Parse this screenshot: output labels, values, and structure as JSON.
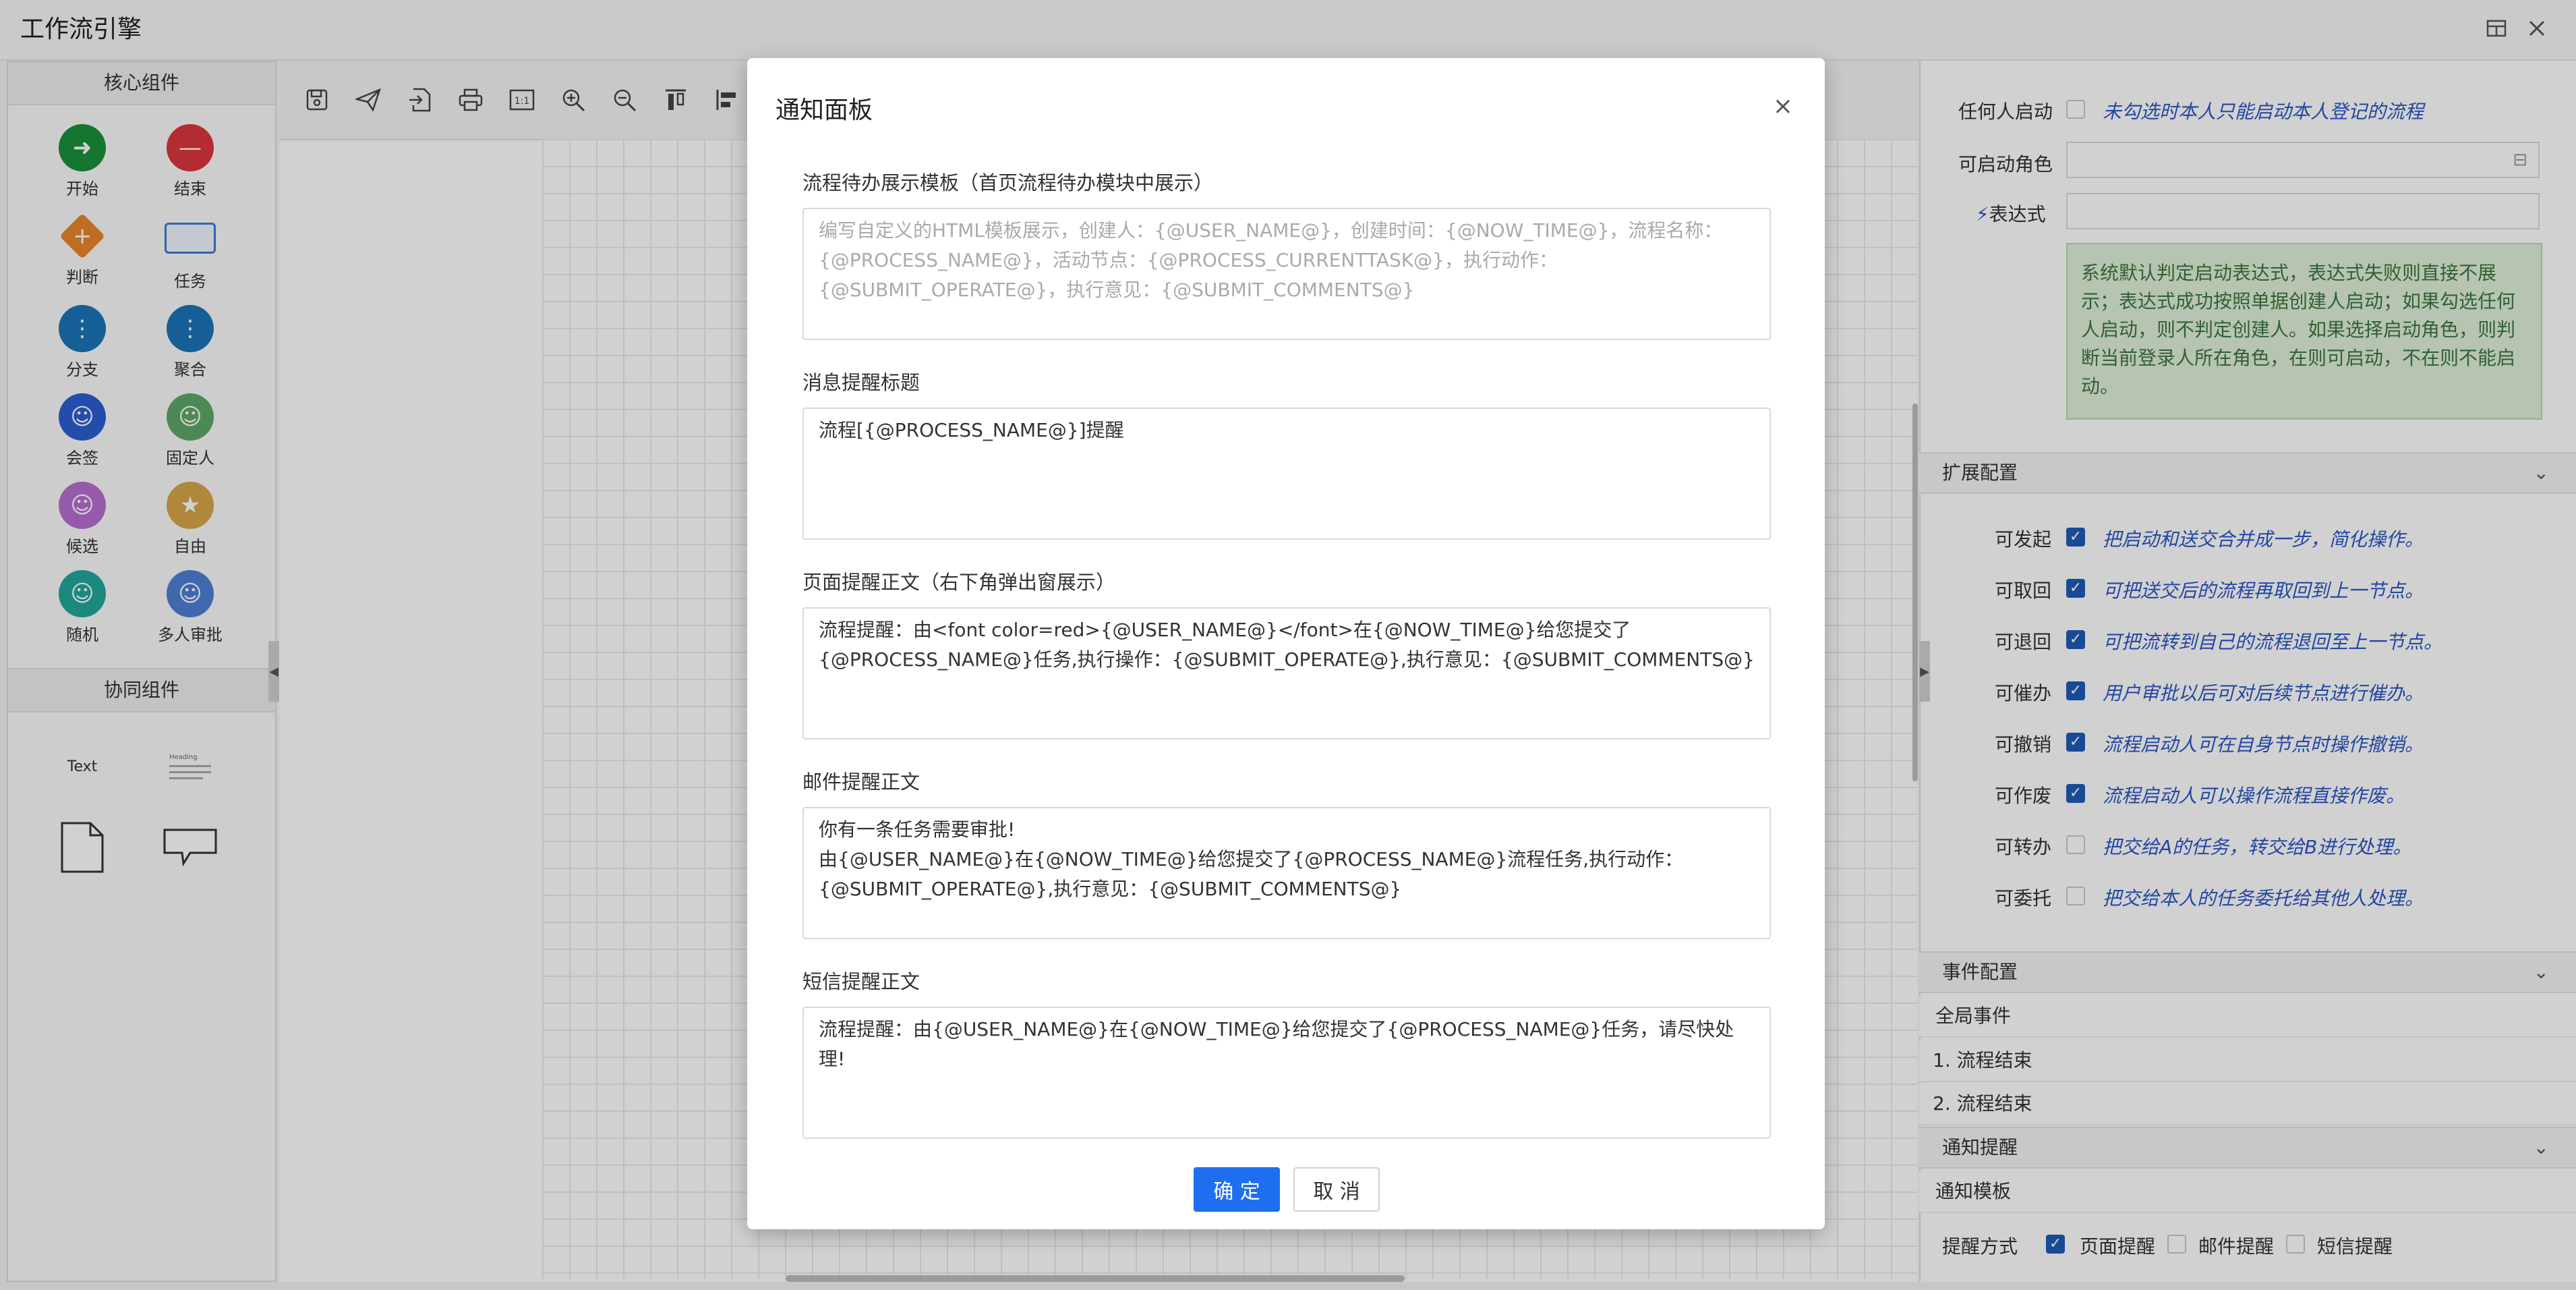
{
  "app": {
    "title": "工作流引擎"
  },
  "left_panel": {
    "core_title": "核心组件",
    "components": [
      {
        "label": "开始",
        "color": "#1c8f3c",
        "glyph": "➜"
      },
      {
        "label": "结束",
        "color": "#d9363e",
        "glyph": "—"
      },
      {
        "label": "判断",
        "color": "#e8852a",
        "glyph": "+"
      },
      {
        "label": "任务",
        "color": "#3a7bd5",
        "glyph": ""
      },
      {
        "label": "分支",
        "color": "#1a74b8",
        "glyph": "⋮"
      },
      {
        "label": "聚合",
        "color": "#1a74b8",
        "glyph": "⋮"
      },
      {
        "label": "会签",
        "color": "#2d5fd1",
        "glyph": "☺"
      },
      {
        "label": "固定人",
        "color": "#5fa86a",
        "glyph": "☺"
      },
      {
        "label": "候选",
        "color": "#b86ed1",
        "glyph": "☺"
      },
      {
        "label": "自由",
        "color": "#d6a74a",
        "glyph": "★"
      },
      {
        "label": "随机",
        "color": "#22a89a",
        "glyph": "☺"
      },
      {
        "label": "多人审批",
        "color": "#4f7fd6",
        "glyph": "☺"
      }
    ],
    "collab_title": "协同组件",
    "collab_text_label": "Text",
    "collab_heading_label": "Heading"
  },
  "right_panel": {
    "anyone_label": "任何人启动",
    "anyone_hint": "未勾选时本人只能启动本人登记的流程",
    "role_label": "可启动角色",
    "expr_label": "表达式",
    "expr_info": "系统默认判定启动表达式，表达式失败则直接不展示；表达式成功按照单据创建人启动；如果勾选任何人启动，则不判定创建人。如果选择启动角色，则判断当前登录人所在角色，在则可启动，不在则不能启动。",
    "ext_title": "扩展配置",
    "options": [
      {
        "label": "可发起",
        "checked": true,
        "hint": "把启动和送交合并成一步，简化操作。"
      },
      {
        "label": "可取回",
        "checked": true,
        "hint": "可把送交后的流程再取回到上一节点。"
      },
      {
        "label": "可退回",
        "checked": true,
        "hint": "可把流转到自己的流程退回至上一节点。"
      },
      {
        "label": "可催办",
        "checked": true,
        "hint": "用户审批以后可对后续节点进行催办。"
      },
      {
        "label": "可撤销",
        "checked": true,
        "hint": "流程启动人可在自身节点时操作撤销。"
      },
      {
        "label": "可作废",
        "checked": true,
        "hint": "流程启动人可以操作流程直接作废。"
      },
      {
        "label": "可转办",
        "checked": false,
        "hint": "把交给A的任务，转交给B进行处理。"
      },
      {
        "label": "可委托",
        "checked": false,
        "hint": "把交给本人的任务委托给其他人处理。"
      }
    ],
    "event_title": "事件配置",
    "global_event": "全局事件",
    "event_items": [
      "1. 流程结束",
      "2. 流程结束"
    ],
    "notify_title": "通知提醒",
    "notify_template": "通知模板",
    "remind_label": "提醒方式",
    "remind_page": "页面提醒",
    "remind_mail": "邮件提醒",
    "remind_sms": "短信提醒"
  },
  "modal": {
    "title": "通知面板",
    "close": "×",
    "fields": [
      {
        "label": "流程待办展示模板（首页流程待办模块中展示）",
        "value": "",
        "placeholder": "编写自定义的HTML模板展示，创建人：{@USER_NAME@}，创建时间：{@NOW_TIME@}，流程名称：{@PROCESS_NAME@}，活动节点：{@PROCESS_CURRENTTASK@}，执行动作：{@SUBMIT_OPERATE@}，执行意见：{@SUBMIT_COMMENTS@}"
      },
      {
        "label": "消息提醒标题",
        "value": "流程[{@PROCESS_NAME@}]提醒",
        "placeholder": ""
      },
      {
        "label": "页面提醒正文（右下角弹出窗展示）",
        "value": "流程提醒：由<font color=red>{@USER_NAME@}</font>在{@NOW_TIME@}给您提交了{@PROCESS_NAME@}任务,执行操作：{@SUBMIT_OPERATE@},执行意见：{@SUBMIT_COMMENTS@}",
        "placeholder": ""
      },
      {
        "label": "邮件提醒正文",
        "value": "你有一条任务需要审批!\n由{@USER_NAME@}在{@NOW_TIME@}给您提交了{@PROCESS_NAME@}流程任务,执行动作：{@SUBMIT_OPERATE@},执行意见：{@SUBMIT_COMMENTS@}",
        "placeholder": ""
      },
      {
        "label": "短信提醒正文",
        "value": "流程提醒：由{@USER_NAME@}在{@NOW_TIME@}给您提交了{@PROCESS_NAME@}任务，请尽快处理!",
        "placeholder": ""
      }
    ],
    "ok": "确 定",
    "cancel": "取 消"
  }
}
